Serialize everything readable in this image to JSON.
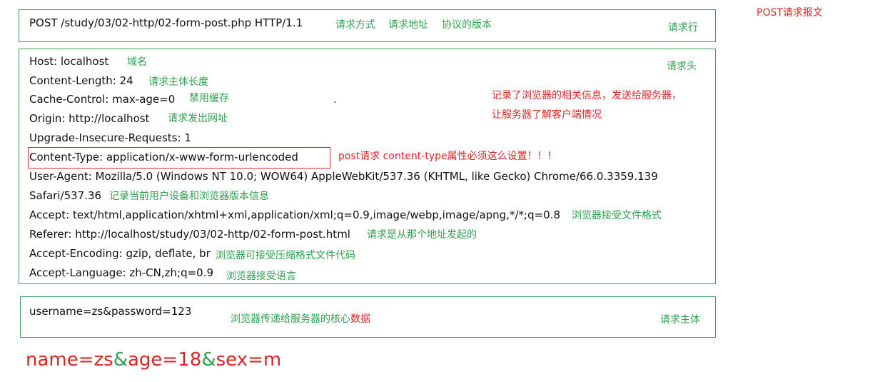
{
  "title": "POST请求报文",
  "request_line": {
    "text": "POST /study/03/02-http/02-form-post.php HTTP/1.1",
    "notes": [
      "请求方式",
      "请求地址",
      "协议的版本"
    ],
    "section_label": "请求行"
  },
  "request_headers": {
    "section_label": "请求头",
    "lines": [
      {
        "text": "Host: localhost",
        "note": "域名"
      },
      {
        "text": "Content-Length: 24",
        "note": "请求主体长度"
      },
      {
        "text": "Cache-Control: max-age=0",
        "note": "禁用缓存"
      },
      {
        "text": "Origin: http://localhost",
        "note": "请求发出网址"
      },
      {
        "text": "Upgrade-Insecure-Requests: 1",
        "note": ""
      },
      {
        "text": "Content-Type: application/x-www-form-urlencoded",
        "note": "post请求 content-type属性必须这么设置！！！"
      },
      {
        "text": "User-Agent: Mozilla/5.0 (Windows NT 10.0; WOW64) AppleWebKit/537.36 (KHTML, like Gecko) Chrome/66.0.3359.139",
        "note": ""
      },
      {
        "text": "Safari/537.36",
        "note": "记录当前用户设备和浏览器版本信息"
      },
      {
        "text": "Accept: text/html,application/xhtml+xml,application/xml;q=0.9,image/webp,image/apng,*/*;q=0.8",
        "note": "浏览器接受文件格式"
      },
      {
        "text": "Referer: http://localhost/study/03/02-http/02-form-post.html",
        "note": "请求是从那个地址发起的"
      },
      {
        "text": "Accept-Encoding: gzip, deflate, br",
        "note": "浏览器可接受压缩格式文件代码"
      },
      {
        "text": "Accept-Language: zh-CN,zh;q=0.9",
        "note": "浏览器接受语言"
      }
    ],
    "side_note": {
      "line1": "记录了浏览器的相关信息，发送给服务器，",
      "line2": "让服务器了解客户端情况"
    },
    "dot": "."
  },
  "request_body": {
    "section_label": "请求主体",
    "text": "username=zs&password=123",
    "note_prefix": "浏览器传递给服务器的核心",
    "note_suffix": "数据"
  },
  "example": {
    "p1": "name=zs",
    "amp1": "&",
    "p2": "age=18",
    "amp2": "&",
    "p3": "sex=m"
  },
  "colors": {
    "green": "#2ea04e",
    "red": "#e02424",
    "border": "#3aa35b",
    "text": "#111111"
  }
}
